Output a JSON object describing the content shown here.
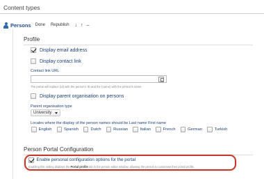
{
  "header": {
    "title": "Content types"
  },
  "persons_row": {
    "label": "Persons",
    "actions": [
      "Done",
      "Republish"
    ],
    "arrows": [
      "↓",
      "↑",
      "–"
    ]
  },
  "profile": {
    "title": "Profile",
    "display_email": "Display email address",
    "display_contact": "Display contact link",
    "contact_url_label": "Contact link URL",
    "contact_url_value": "",
    "contact_url_hint": "The portal will replace {id} with the person's ID and the {name} with the person's name.",
    "display_parent_org": "Display parent organisation on persons",
    "parent_org_type_label": "Parent organisation type",
    "parent_org_type_value": "University",
    "locales_label": "Locales where the display of the person names should be Last name First name",
    "locales": [
      "English",
      "Spanish",
      "Dutch",
      "Russian",
      "Italian",
      "French",
      "German",
      "Turkish"
    ]
  },
  "portal_config": {
    "title": "Person Portal Configuration",
    "enable_label": "Enable personal configuration options for the portal",
    "hint_prefix": "Enabling this setting displays the ",
    "hint_bold": "Portal profile",
    "hint_suffix": " tab in the person editor window, allowing the person to customise their portal profile."
  },
  "icons": {
    "person": "person-icon",
    "url_picker": "url-picker-icon",
    "caret": "chevron-down-icon",
    "check": "check-icon"
  },
  "colors": {
    "link_blue": "#1f3f7a",
    "persons_blue": "#1f4f8c",
    "highlight_red": "#c0392b"
  }
}
